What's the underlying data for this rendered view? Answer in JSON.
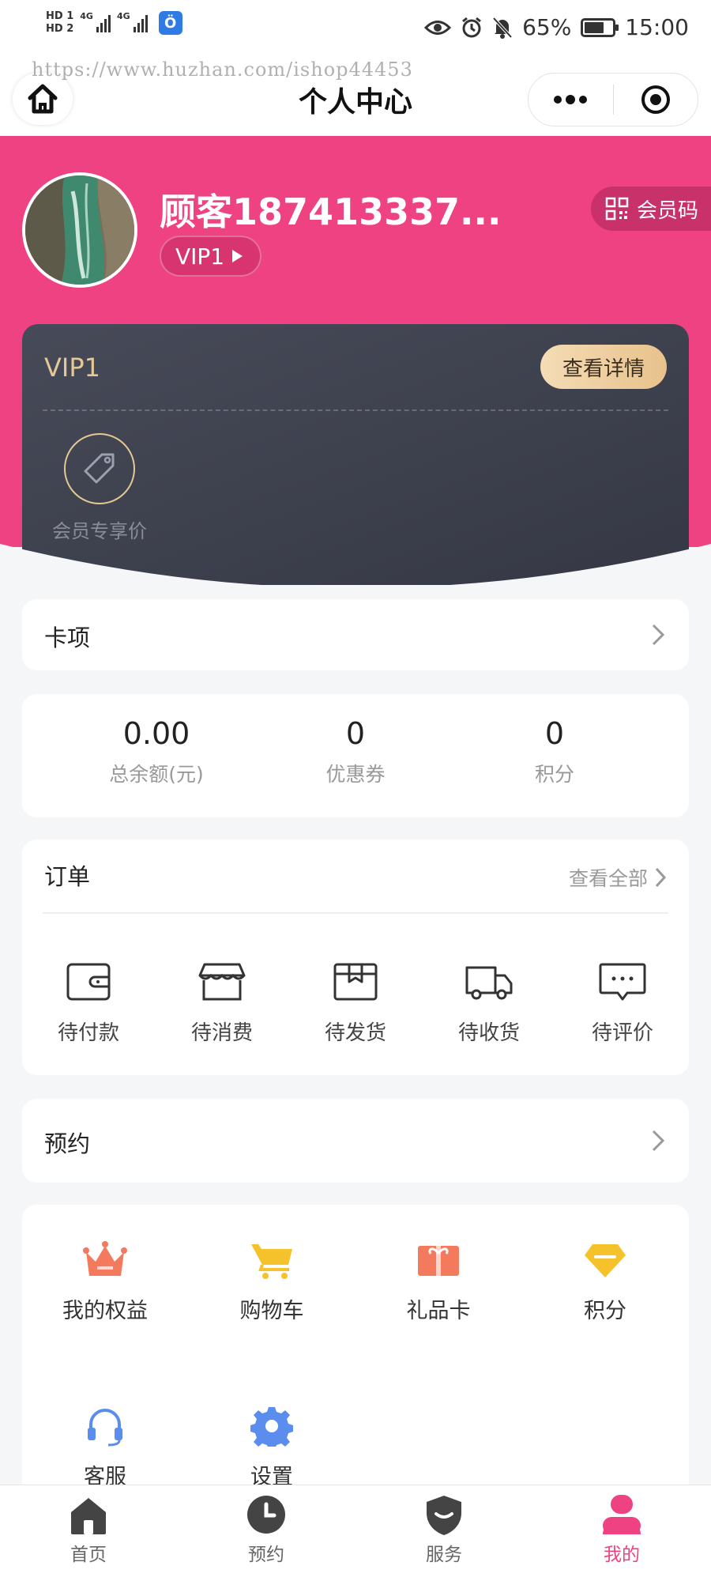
{
  "status_bar": {
    "hd_1": "HD 1",
    "hd_2": "HD 2",
    "net_1": "4G",
    "net_2": "4G",
    "battery_percent": "65%",
    "time": "15:00"
  },
  "navbar": {
    "watermark": "https://www.huzhan.com/ishop44453",
    "title": "个人中心"
  },
  "profile": {
    "username": "顾客187413337...",
    "vip_badge": "VIP1",
    "member_code_label": "会员码"
  },
  "vip_card": {
    "level": "VIP1",
    "detail_button": "查看详情",
    "perk_label": "会员专享价"
  },
  "card_items": {
    "title": "卡项"
  },
  "stats": [
    {
      "value": "0.00",
      "label": "总余额(元)"
    },
    {
      "value": "0",
      "label": "优惠券"
    },
    {
      "value": "0",
      "label": "积分"
    }
  ],
  "orders": {
    "title": "订单",
    "view_all": "查看全部",
    "items": [
      {
        "label": "待付款",
        "icon": "wallet-icon"
      },
      {
        "label": "待消费",
        "icon": "shop-icon"
      },
      {
        "label": "待发货",
        "icon": "box-icon"
      },
      {
        "label": "待收货",
        "icon": "truck-icon"
      },
      {
        "label": "待评价",
        "icon": "comment-icon"
      }
    ]
  },
  "booking": {
    "title": "预约"
  },
  "services": [
    {
      "label": "我的权益",
      "icon": "crown-icon"
    },
    {
      "label": "购物车",
      "icon": "cart-icon"
    },
    {
      "label": "礼品卡",
      "icon": "gift-card-icon"
    },
    {
      "label": "积分",
      "icon": "diamond-icon"
    },
    {
      "label": "客服",
      "icon": "headset-icon"
    },
    {
      "label": "设置",
      "icon": "gear-icon"
    }
  ],
  "tabbar": {
    "items": [
      {
        "label": "首页",
        "icon": "home-icon"
      },
      {
        "label": "预约",
        "icon": "clock-icon"
      },
      {
        "label": "服务",
        "icon": "shield-icon"
      },
      {
        "label": "我的",
        "icon": "user-icon"
      }
    ],
    "active_index": 3
  },
  "colors": {
    "brand": "#ef4282",
    "vip_gold": "#e4c895",
    "card_dark": "#3d404d"
  }
}
